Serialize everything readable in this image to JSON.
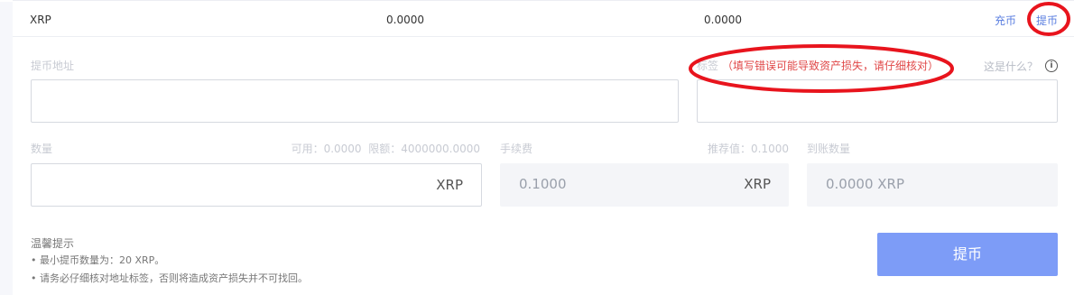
{
  "row": {
    "coin": "XRP",
    "available": "0.0000",
    "frozen": "0.0000",
    "deposit_label": "充币",
    "withdraw_label": "提币"
  },
  "form": {
    "address": {
      "label": "提币地址",
      "value": ""
    },
    "tag": {
      "label": "标签",
      "warning": "（填写错误可能导致资产损失，请仔细核对）",
      "help": "这是什么？",
      "help_icon": "info-icon",
      "value": ""
    },
    "amount": {
      "label": "数量",
      "limits": "可用：0.0000  限额：4000000.0000",
      "unit": "XRP",
      "value": ""
    },
    "fee": {
      "label": "手续费",
      "recommend": "推荐值：0.1000",
      "value": "0.1000",
      "unit": "XRP"
    },
    "received": {
      "label": "到账数量",
      "value": "0.0000 XRP"
    }
  },
  "tips": {
    "title": "温馨提示",
    "items": [
      "• 最小提币数量为：20 XRP。",
      "• 请务必仔细核对地址标签，否则将造成资产损失并不可找回。"
    ]
  },
  "submit_label": "提币",
  "annotations": {
    "color": "#e8141d"
  },
  "colors": {
    "accent": "#7d9cf7",
    "link": "#5b7fe0",
    "warning": "#e04848"
  }
}
